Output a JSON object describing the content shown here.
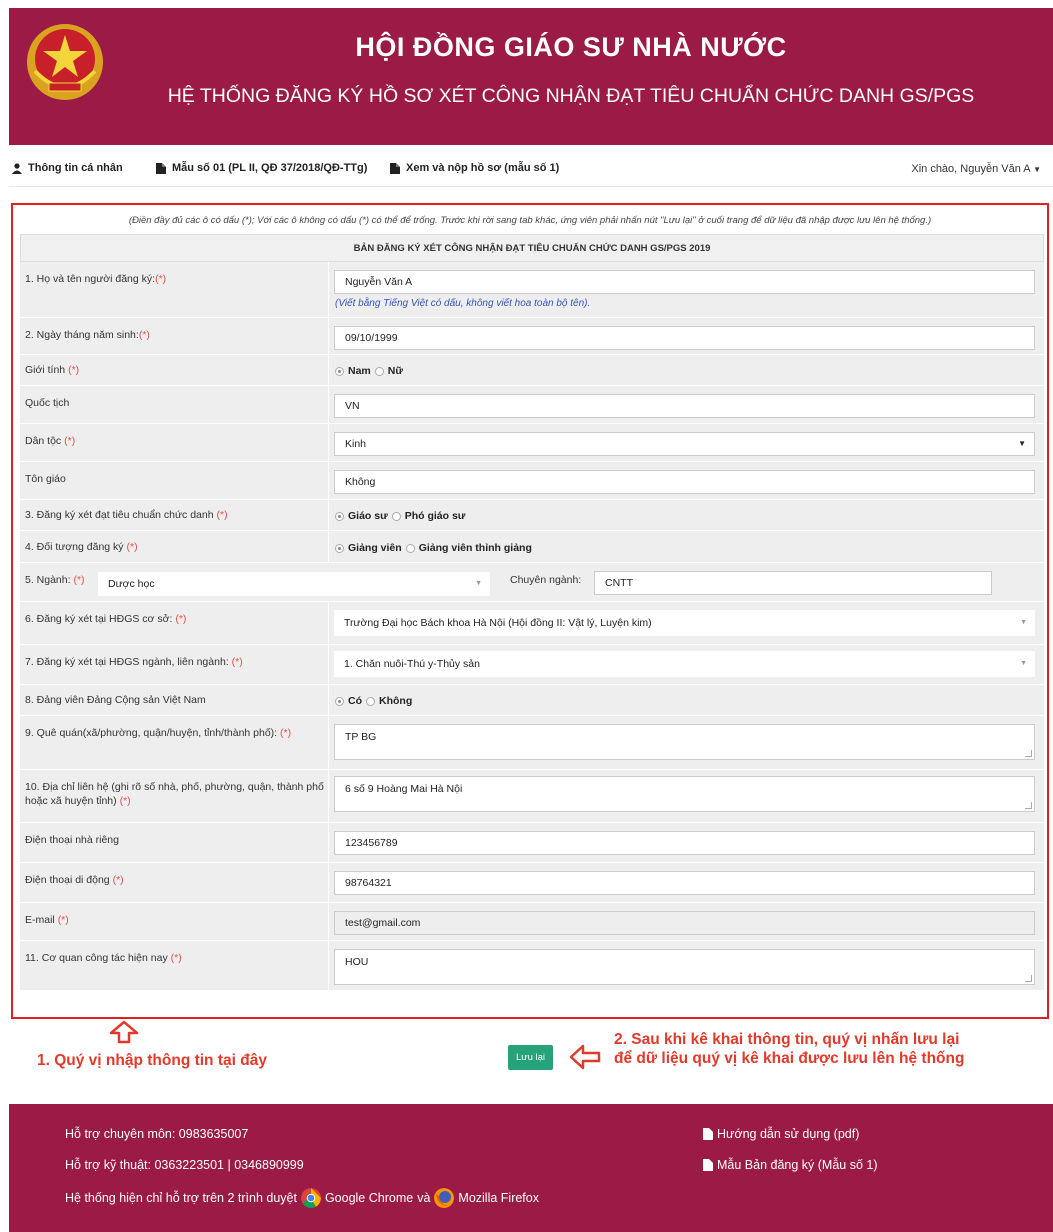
{
  "header": {
    "title": "HỘI ĐỒNG GIÁO SƯ NHÀ NƯỚC",
    "subtitle": "HỆ THỐNG ĐĂNG KÝ HỒ SƠ XÉT CÔNG NHẬN ĐẠT TIÊU CHUẨN CHỨC DANH GS/PGS"
  },
  "nav": {
    "items": [
      {
        "label": "Thông tin cá nhân",
        "icon": "user-icon"
      },
      {
        "label": "Mẫu số 01 (PL II, QĐ 37/2018/QĐ-TTg)",
        "icon": "file-icon"
      },
      {
        "label": "Xem và nộp hồ sơ (mẫu số 1)",
        "icon": "file-icon"
      }
    ],
    "greeting": "Xin chào, Nguyễn Văn A"
  },
  "form": {
    "note": "(Điền đầy đủ các ô có dấu (*); Với các ô không có dấu (*) có thể để trống. Trước khi rời sang tab khác, ứng viên phải nhấn nút \"Lưu lại\" ở cuối trang để dữ liệu đã nhập được lưu lên hệ thống.)",
    "title": "BẢN ĐĂNG KÝ XÉT CÔNG NHẬN ĐẠT TIÊU CHUẨN CHỨC DANH GS/PGS 2019",
    "required_mark": "(*)",
    "name": {
      "label": "1. Họ và tên người đăng ký:",
      "value": "Nguyễn Văn A",
      "hint": "(Viết bằng Tiếng Việt có dấu, không viết hoa toàn bộ tên)."
    },
    "dob": {
      "label": "2. Ngày tháng năm sinh:",
      "value": "09/10/1999"
    },
    "gender": {
      "label": "Giới tính",
      "options": [
        "Nam",
        "Nữ"
      ],
      "selected": "Nam"
    },
    "nationality": {
      "label": "Quốc tịch",
      "value": "VN"
    },
    "ethnicity": {
      "label": "Dân tộc",
      "value": "Kinh"
    },
    "religion": {
      "label": "Tôn giáo",
      "value": "Không"
    },
    "title_reg": {
      "label": "3. Đăng ký xét đạt tiêu chuẩn chức danh",
      "options": [
        "Giáo sư",
        "Phó giáo sư"
      ],
      "selected": "Giáo sư"
    },
    "target": {
      "label": "4. Đối tượng đăng ký",
      "options": [
        "Giảng viên",
        "Giảng viên thỉnh giảng"
      ],
      "selected": "Giảng viên"
    },
    "field": {
      "label": "5. Ngành:",
      "value": "Dược học",
      "spec_label": "Chuyên ngành:",
      "spec_value": "CNTT"
    },
    "council_base": {
      "label": "6. Đăng ký xét tại HĐGS cơ sở:",
      "value": "Trường Đại học Bách khoa Hà Nội (Hội đồng II: Vật lý, Luyện kim)"
    },
    "council_field": {
      "label": "7. Đăng ký xét tại HĐGS ngành, liên ngành:",
      "value": "1. Chăn nuôi-Thú y-Thủy sản"
    },
    "party": {
      "label": "8. Đảng viên Đảng Cộng sản Việt Nam",
      "options": [
        "Có",
        "Không"
      ],
      "selected": "Có"
    },
    "hometown": {
      "label": "9. Quê quán(xã/phường, quận/huyện, tỉnh/thành phố):",
      "value": "TP BG"
    },
    "address": {
      "label": "10. Địa chỉ liên hệ (ghi rõ số nhà, phố, phường, quận, thành phố hoặc xã huyện tỉnh)",
      "value": "6 số 9 Hoàng Mai Hà Nội"
    },
    "home_phone": {
      "label": "Điện thoại nhà riêng",
      "value": "123456789"
    },
    "mobile": {
      "label": "Điện thoại di động",
      "value": "98764321"
    },
    "email": {
      "label": "E-mail",
      "value": "test@gmail.com"
    },
    "agency": {
      "label": "11. Cơ quan công tác hiện nay",
      "value": "HOU"
    }
  },
  "annotations": {
    "left": "1. Quý vị nhập thông tin tại đây",
    "right": "2. Sau khi kê khai thông tin, quý vị nhấn lưu lại để dữ liệu quý vị kê khai được lưu lên hệ thống"
  },
  "save_label": "Lưu lại",
  "footer": {
    "support_pro": "Hỗ trợ chuyên môn: 0983635007",
    "support_tech": "Hỗ trợ kỹ thuật: 0363223501 | 0346890999",
    "browsers_prefix": "Hệ thống hiện chỉ hỗ trợ trên 2 trình duyệt",
    "chrome": "Google Chrome",
    "and": "và",
    "firefox": "Mozilla Firefox",
    "guide": "Hướng dẫn sử dụng (pdf)",
    "template": "Mẫu Bản đăng ký (Mẫu số 1)"
  },
  "colors": {
    "brand": "#9b1a46",
    "accent_red": "#e23a2a",
    "save_button": "#26a37a"
  }
}
